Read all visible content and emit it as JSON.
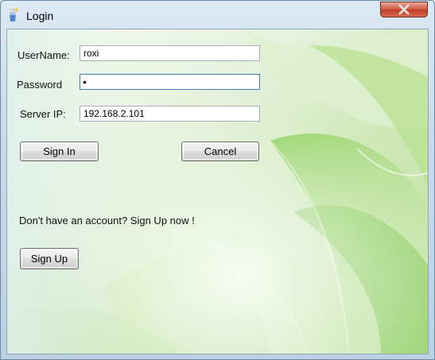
{
  "window": {
    "title": "Login",
    "close_label": "Close"
  },
  "form": {
    "username_label": "UserName:",
    "username_value": "roxi",
    "password_label": "Password",
    "password_mask": "•",
    "server_ip_label": "Server IP:",
    "server_ip_value": "192.168.2.101"
  },
  "buttons": {
    "sign_in": "Sign In",
    "cancel": "Cancel",
    "sign_up": "Sign Up"
  },
  "signup_prompt": "Don't have an account? Sign Up now !",
  "colors": {
    "close_button": "#c8452f",
    "background_green": "#9ad46a",
    "background_light": "#eef6e4"
  }
}
